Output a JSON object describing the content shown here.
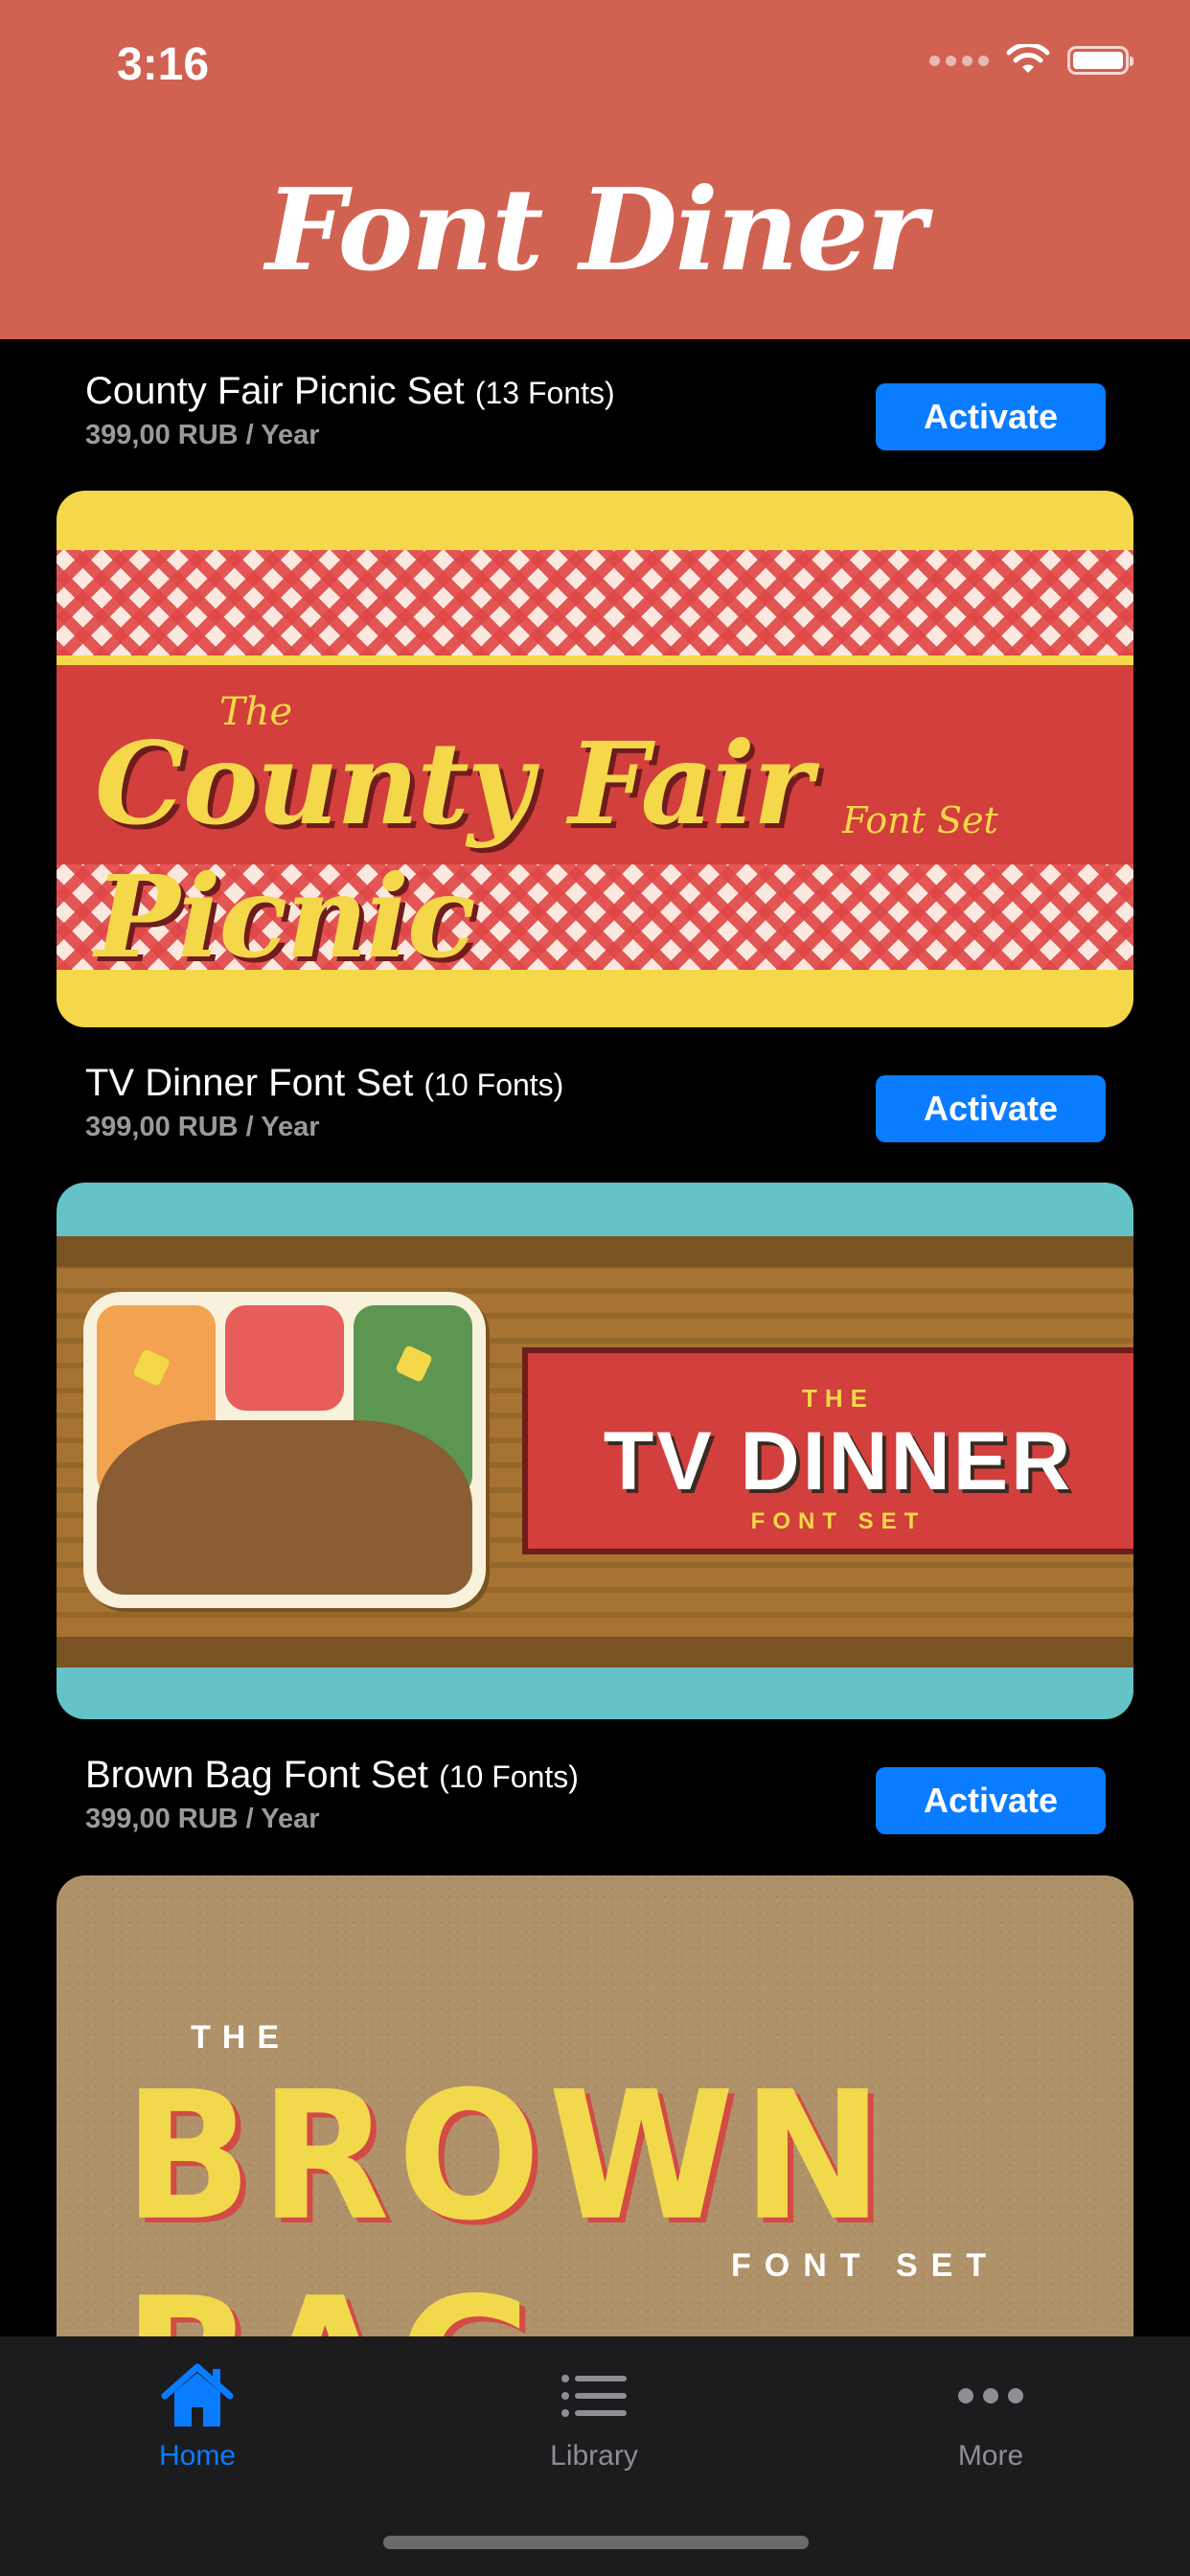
{
  "status_bar": {
    "time": "3:16"
  },
  "header": {
    "title": "Font Diner"
  },
  "font_sets": [
    {
      "name": "County Fair Picnic Set",
      "count": "(13 Fonts)",
      "price": "399,00 RUB / Year",
      "action": "Activate",
      "banner": {
        "pre": "The",
        "title": "County Fair Picnic",
        "sub": "Font Set"
      }
    },
    {
      "name": "TV Dinner Font Set",
      "count": "(10 Fonts)",
      "price": "399,00 RUB / Year",
      "action": "Activate",
      "banner": {
        "pre": "THE",
        "title": "TV DINNER",
        "sub": "FONT SET"
      }
    },
    {
      "name": "Brown Bag Font Set",
      "count": "(10 Fonts)",
      "price": "399,00 RUB / Year",
      "action": "Activate",
      "banner": {
        "pre": "THE",
        "title": "BROWN BAG",
        "sub": "FONT SET"
      }
    }
  ],
  "tabbar": {
    "items": [
      {
        "label": "Home",
        "icon": "house-icon",
        "active": true
      },
      {
        "label": "Library",
        "icon": "list-icon",
        "active": false
      },
      {
        "label": "More",
        "icon": "ellipsis-icon",
        "active": false
      }
    ]
  },
  "colors": {
    "header_bg": "#d16252",
    "accent": "#0a7cff",
    "inactive_tab": "#8e8e93"
  }
}
